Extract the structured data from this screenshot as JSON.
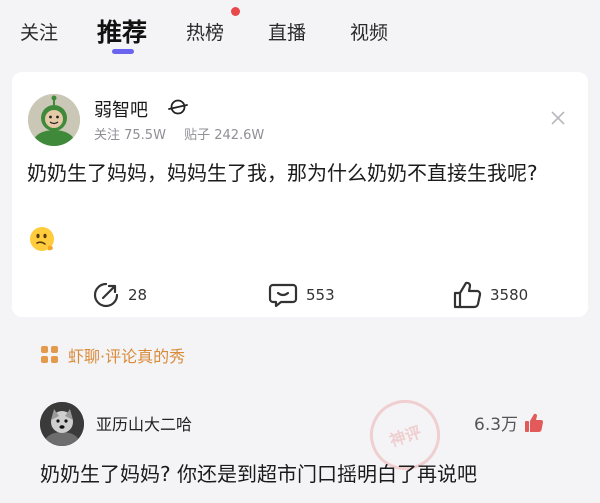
{
  "tabs": [
    {
      "label": "关注",
      "active": false
    },
    {
      "label": "推荐",
      "active": true
    },
    {
      "label": "热榜",
      "active": false,
      "badge_dot": true
    },
    {
      "label": "直播",
      "active": false
    },
    {
      "label": "视频",
      "active": false
    }
  ],
  "colors": {
    "accent": "#6a63f0",
    "badge": "#e8484a",
    "section_title": "#d98b3a",
    "like_red": "#e25a5a"
  },
  "post": {
    "forum_name": "弱智吧",
    "forum_icon": "planet-icon",
    "followers": "关注 75.5W",
    "posts": "贴子 242.6W",
    "text": "奶奶生了妈妈，妈妈生了我，那为什么奶奶不直接生我呢?",
    "emoji": "thinking-face-icon",
    "actions": {
      "share_count": "28",
      "comment_count": "553",
      "like_count": "3580"
    }
  },
  "comments_section": {
    "title": "虾聊·评论真的秀",
    "comment": {
      "username": "亚历山大二哈",
      "likes": "6.3万",
      "text": "奶奶生了妈妈? 你还是到超市门口摇明白了再说吧",
      "watermark": "神评"
    }
  }
}
